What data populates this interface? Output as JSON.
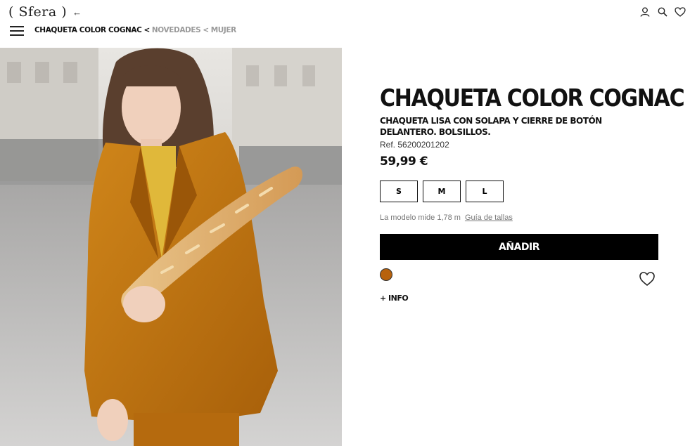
{
  "header": {
    "logo": "( Sfera )",
    "back_arrow": "←",
    "icons": [
      "user-icon",
      "search-icon",
      "heart-icon"
    ]
  },
  "breadcrumb": {
    "current": "CHAQUETA COLOR COGNAC",
    "separator": "<",
    "items": [
      "NOVEDADES",
      "MUJER"
    ]
  },
  "photo": {
    "accent_jacket": "#c07410",
    "accent_top": "#e0b83a"
  },
  "product": {
    "title": "CHAQUETA COLOR COGNAC",
    "subtitle": "CHAQUETA LISA CON SOLAPA Y CIERRE DE BOTÓN DELANTERO. BOLSILLOS.",
    "ref": "Ref. 56200201202",
    "price": "59,99 €",
    "sizes": [
      "S",
      "M",
      "L"
    ],
    "model_note": "La modelo mide 1,78 m",
    "size_guide": "Guía de tallas",
    "add_button": "AÑADIR",
    "color_swatch": "#b8620c",
    "more_info": "+ INFO"
  }
}
